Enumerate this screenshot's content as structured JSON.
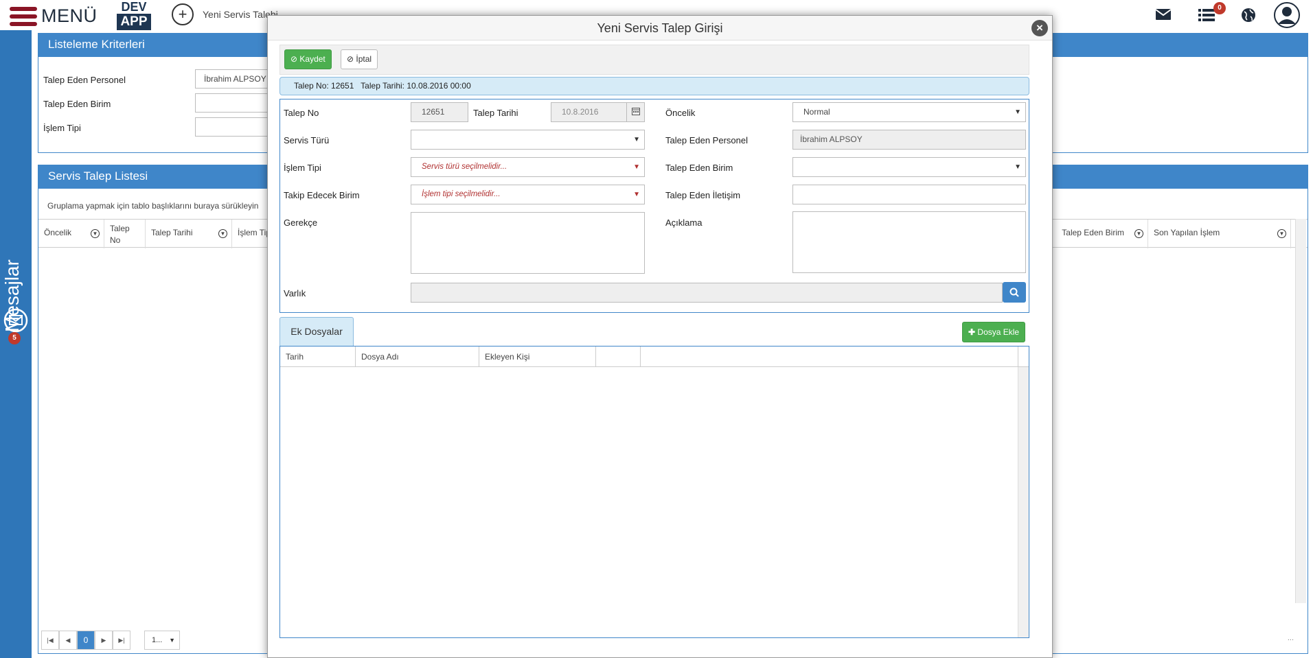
{
  "topbar": {
    "menu_label": "MENÜ",
    "logo_line1": "DEV",
    "logo_line2": "APP",
    "tab_label": "Yeni Servis Talebi",
    "list_badge": "0"
  },
  "sidebar": {
    "messages_label": "Mesajlar",
    "messages_badge": "5"
  },
  "criteria_panel": {
    "title": "Listeleme Kriterleri",
    "fields": [
      {
        "label": "Talep Eden Personel",
        "value": "İbrahim ALPSOY"
      },
      {
        "label": "Talep Eden Birim",
        "value": ""
      },
      {
        "label": "İşlem Tipi",
        "value": ""
      }
    ]
  },
  "list_panel": {
    "title": "Servis Talep Listesi",
    "group_hint": "Gruplama yapmak için tablo başlıklarını buraya sürükleyin",
    "columns": [
      "Öncelik",
      "Talep No",
      "Talep Tarihi",
      "İşlem Tipi",
      "Talep Eden Birim",
      "Son Yapılan İşlem"
    ],
    "pager": {
      "current_page": "0",
      "page_size": "1..."
    },
    "footer_dots": "..."
  },
  "modal": {
    "title": "Yeni Servis Talep Girişi",
    "close_symbol": "×",
    "toolbar": {
      "save_label": "Kaydet",
      "cancel_label": "İptal"
    },
    "info": "Talep No: 12651   Talep Tarihi: 10.08.2016 00:00",
    "form": {
      "talep_no_label": "Talep No",
      "talep_no_value": "12651",
      "talep_tarihi_label": "Talep Tarihi",
      "talep_tarihi_value": "10.8.2016",
      "oncelik_label": "Öncelik",
      "oncelik_value": "Normal",
      "servis_turu_label": "Servis Türü",
      "servis_turu_value": "",
      "talep_eden_personel_label": "Talep Eden Personel",
      "talep_eden_personel_value": "İbrahim ALPSOY",
      "islem_tipi_label": "İşlem Tipi",
      "islem_tipi_placeholder": "Servis türü seçilmelidir...",
      "talep_eden_birim_label": "Talep Eden Birim",
      "talep_eden_birim_value": "",
      "takip_edecek_birim_label": "Takip Edecek Birim",
      "takip_edecek_birim_placeholder": "İşlem tipi seçilmelidir...",
      "talep_eden_iletisim_label": "Talep Eden İletişim",
      "talep_eden_iletisim_value": "",
      "gerekce_label": "Gerekçe",
      "aciklama_label": "Açıklama",
      "varlik_label": "Varlık",
      "varlik_value": ""
    },
    "attachments": {
      "tab_label": "Ek Dosyalar",
      "add_button": "Dosya Ekle",
      "columns": [
        "Tarih",
        "Dosya Adı",
        "Ekleyen Kişi",
        ""
      ]
    }
  },
  "colors": {
    "primary_blue": "#3f86c9",
    "success_green": "#4caf50",
    "brand_dark": "#1e3652",
    "menu_red": "#8a1526",
    "badge_red": "#c0392b"
  }
}
